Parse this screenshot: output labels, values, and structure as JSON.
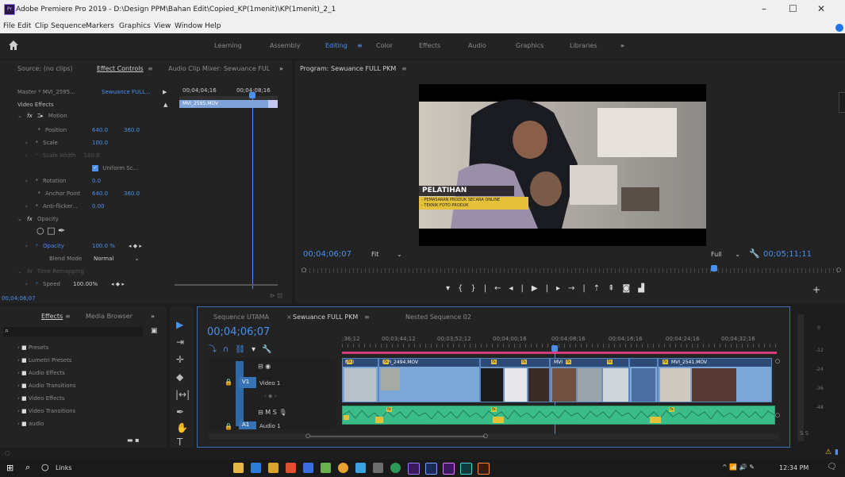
{
  "window": {
    "title": "Adobe Premiere Pro 2019 - D:\\Design PPM\\Bahan Edit\\Copied_KP(1menit)\\KP(1menit)_2_1",
    "app_badge": "Pr",
    "min": "–",
    "max": "☐",
    "close": "✕"
  },
  "menu": [
    "File",
    "Edit",
    "Clip",
    "Sequence",
    "Markers",
    "Graphics",
    "View",
    "Window",
    "Help"
  ],
  "workspaces": {
    "items": [
      "Learning",
      "Assembly",
      "Editing",
      "Color",
      "Effects",
      "Audio",
      "Graphics",
      "Libraries"
    ],
    "editing_suffix": "≡",
    "more": "»"
  },
  "source_tabs": {
    "source": "Source: (no clips)",
    "effect_controls": "Effect Controls",
    "menu_glyph": "≡",
    "audio_mixer": "Audio Clip Mixer: Sewuance FUL",
    "more": "»"
  },
  "effect_controls": {
    "master": "Master * MVI_2595...",
    "sequence": "Sewuance FULL...",
    "time_start": "00;04;04;16",
    "time_end": "00;04;08;16",
    "clip_name": "MVI_2595.MOV",
    "section": "Video Effects",
    "motion": "Motion",
    "position_label": "Position",
    "position_x": "640.0",
    "position_y": "360.0",
    "scale_label": "Scale",
    "scale_val": "100.0",
    "scale_width_label": "Scale Width",
    "scale_width_val": "100.0",
    "uniform_label": "Uniform Sc...",
    "rotation_label": "Rotation",
    "rotation_val": "0.0",
    "anchor_label": "Anchor Point",
    "anchor_x": "640.0",
    "anchor_y": "360.0",
    "antiflicker_label": "Anti-flicker...",
    "antiflicker_val": "0.00",
    "opacity_section": "Opacity",
    "opacity_label": "Opacity",
    "opacity_val": "100.0 %",
    "blend_label": "Blend Mode",
    "blend_val": "Normal",
    "time_remap": "Time Remapping",
    "speed_label": "Speed",
    "speed_val": "100.00%",
    "timecode": "00;04;06;07"
  },
  "program": {
    "title": "Program: Sewuance FULL PKM",
    "menu_glyph": "≡",
    "current_tc": "00;04;06;07",
    "fit": "Fit",
    "quality": "Full",
    "duration": "00;05;11;11",
    "lower_third_title": "PELATIHAN",
    "lower_third_line1": "- PEMASARAN PRODUK SECARA ONLINE",
    "lower_third_line2": "- TEKNIK FOTO PRODUK"
  },
  "effects_panel": {
    "tab_effects": "Effects",
    "tab_media": "Media Browser",
    "menu_glyph": "≡",
    "more": "»",
    "items": [
      "Presets",
      "Lumetri Presets",
      "Audio Effects",
      "Audio Transitions",
      "Video Effects",
      "Video Transitions",
      "audio"
    ]
  },
  "timeline": {
    "tabs": [
      "Sequence UTAMA",
      "Sewuance FULL PKM",
      "Nested Sequence 02"
    ],
    "active_menu": "≡",
    "close_glyph": "×",
    "timecode": "00;04;06;07",
    "ruler": [
      ";36;12",
      "00;03;44;12",
      "00;03;52;12",
      "00;04;00;16",
      "00;04;08;16",
      "00;04;16;16",
      "00;04;24;16",
      "00;04;32;16"
    ],
    "v1_label": "V1",
    "v1_name": "Video 1",
    "a1_label": "A1",
    "a1_name": "Audio 1",
    "clip_labels": [
      "MVI",
      "MVI_2494.MOV",
      "MVI",
      "MVI_2541.MOV"
    ],
    "fx_badge": "fx",
    "meter_db": [
      "0",
      "-12",
      "-24",
      "-36",
      "-48"
    ],
    "meter_bottom": "S S"
  },
  "taskbar": {
    "search_label": "Links",
    "time": "12:34 PM"
  },
  "colors": {
    "accent": "#4a90f0",
    "video_clip": "#7ca6d6",
    "audio_clip": "#3bbd8a",
    "fx_badge": "#e5c13a",
    "workarea": "#d43d7d"
  }
}
